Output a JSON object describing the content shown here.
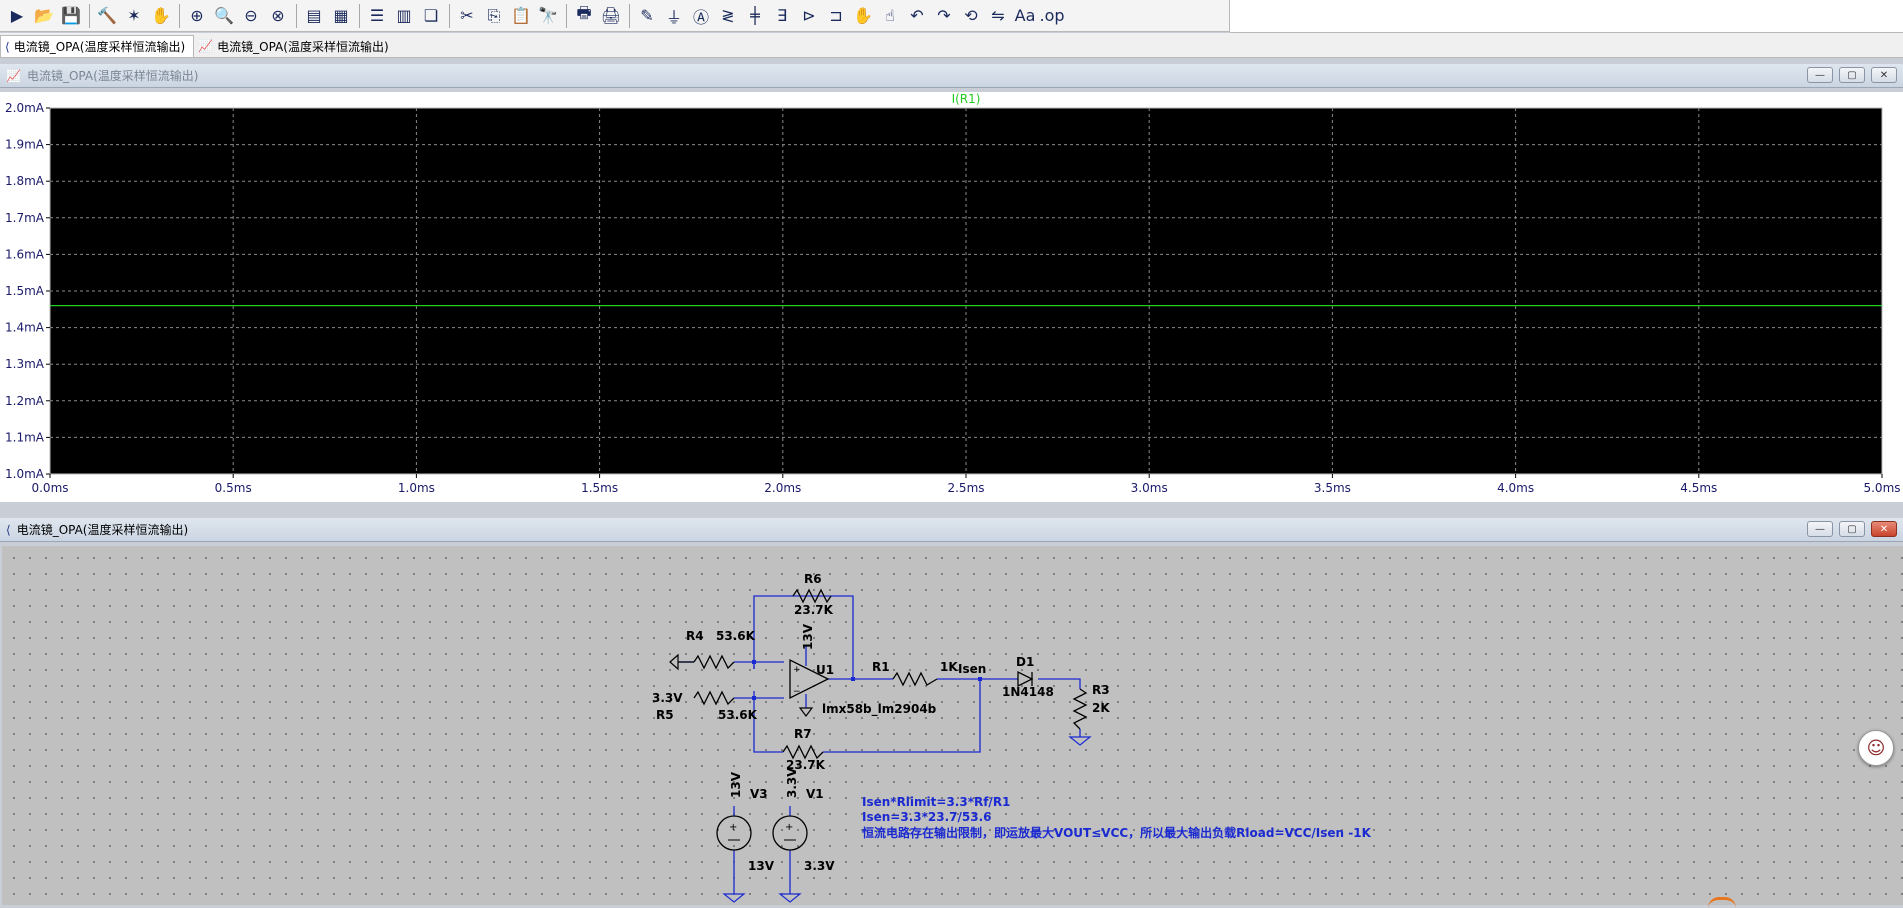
{
  "toolbar": {
    "icons": [
      {
        "name": "run-icon",
        "glyph": "▶"
      },
      {
        "name": "open-icon",
        "glyph": "📂"
      },
      {
        "name": "save-icon",
        "glyph": "💾"
      },
      {
        "sep": true
      },
      {
        "name": "control-panel-icon",
        "glyph": "🔨"
      },
      {
        "name": "halt-icon",
        "glyph": "✶"
      },
      {
        "name": "pan-hand-icon",
        "glyph": "✋"
      },
      {
        "sep": true
      },
      {
        "name": "zoom-in-icon",
        "glyph": "⊕"
      },
      {
        "name": "zoom-area-icon",
        "glyph": "🔍"
      },
      {
        "name": "zoom-out-icon",
        "glyph": "⊖"
      },
      {
        "name": "zoom-fit-icon",
        "glyph": "⊗"
      },
      {
        "sep": true
      },
      {
        "name": "autorange-icon",
        "glyph": "▤"
      },
      {
        "name": "grid-icon",
        "glyph": "▦"
      },
      {
        "sep": true
      },
      {
        "name": "tile-horizontal-icon",
        "glyph": "☰"
      },
      {
        "name": "tile-vertical-icon",
        "glyph": "▥"
      },
      {
        "name": "cascade-icon",
        "glyph": "❏"
      },
      {
        "sep": true
      },
      {
        "name": "cut-icon",
        "glyph": "✂"
      },
      {
        "name": "copy-icon",
        "glyph": "⎘"
      },
      {
        "name": "paste-icon",
        "glyph": "📋"
      },
      {
        "name": "find-icon",
        "glyph": "🔭"
      },
      {
        "sep": true
      },
      {
        "name": "print-icon",
        "glyph": "🖶"
      },
      {
        "name": "print-preview-icon",
        "glyph": "🖨"
      },
      {
        "sep": true
      },
      {
        "name": "draw-wire-icon",
        "glyph": "✎"
      },
      {
        "name": "ground-icon",
        "glyph": "⏚"
      },
      {
        "name": "label-net-icon",
        "glyph": "Ⓐ"
      },
      {
        "name": "resistor-icon",
        "glyph": "≷"
      },
      {
        "name": "capacitor-icon",
        "glyph": "╪"
      },
      {
        "name": "inductor-icon",
        "glyph": "∃"
      },
      {
        "name": "diode-icon",
        "glyph": "⊳"
      },
      {
        "name": "component-icon",
        "glyph": "⊐"
      },
      {
        "name": "move-icon",
        "glyph": "✋"
      },
      {
        "name": "drag-icon",
        "glyph": "☝"
      },
      {
        "name": "undo-icon",
        "glyph": "↶"
      },
      {
        "name": "redo-icon",
        "glyph": "↷"
      },
      {
        "name": "rotate-icon",
        "glyph": "⟲"
      },
      {
        "name": "mirror-icon",
        "glyph": "⇋"
      },
      {
        "name": "text-icon",
        "glyph": "Aa"
      },
      {
        "name": "spice-directive-icon",
        "glyph": ".op"
      }
    ]
  },
  "tabs": [
    {
      "label": "电流镜_OPA(温度采样恒流输出)",
      "icon": "schematic-icon",
      "active": true
    },
    {
      "label": "电流镜_OPA(温度采样恒流输出)",
      "icon": "waveform-icon",
      "active": false
    }
  ],
  "waveform_window": {
    "title": "电流镜_OPA(温度采样恒流输出)",
    "buttons": {
      "min": "—",
      "max": "▢",
      "close": "✕"
    }
  },
  "schematic_window": {
    "title": "电流镜_OPA(温度采样恒流输出)",
    "buttons": {
      "min": "—",
      "max": "▢",
      "close": "✕"
    }
  },
  "chart_data": {
    "type": "line",
    "title": "I(R1)",
    "xlabel": "",
    "ylabel": "",
    "xlim": [
      0.0,
      5.0
    ],
    "ylim": [
      1.0,
      2.0
    ],
    "grid": true,
    "background": "#000000",
    "grid_color": "#8a8a8a",
    "series": [
      {
        "name": "I(R1)",
        "color": "#22cc22",
        "x": [
          0.0,
          5.0
        ],
        "y": [
          1.46,
          1.46
        ]
      }
    ],
    "x_ticks": [
      {
        "v": 0.0,
        "label": "0.0ms"
      },
      {
        "v": 0.5,
        "label": "0.5ms"
      },
      {
        "v": 1.0,
        "label": "1.0ms"
      },
      {
        "v": 1.5,
        "label": "1.5ms"
      },
      {
        "v": 2.0,
        "label": "2.0ms"
      },
      {
        "v": 2.5,
        "label": "2.5ms"
      },
      {
        "v": 3.0,
        "label": "3.0ms"
      },
      {
        "v": 3.5,
        "label": "3.5ms"
      },
      {
        "v": 4.0,
        "label": "4.0ms"
      },
      {
        "v": 4.5,
        "label": "4.5ms"
      },
      {
        "v": 5.0,
        "label": "5.0ms"
      }
    ],
    "y_ticks": [
      {
        "v": 2.0,
        "label": "2.0mA"
      },
      {
        "v": 1.9,
        "label": "1.9mA"
      },
      {
        "v": 1.8,
        "label": "1.8mA"
      },
      {
        "v": 1.7,
        "label": "1.7mA"
      },
      {
        "v": 1.6,
        "label": "1.6mA"
      },
      {
        "v": 1.5,
        "label": "1.5mA"
      },
      {
        "v": 1.4,
        "label": "1.4mA"
      },
      {
        "v": 1.3,
        "label": "1.3mA"
      },
      {
        "v": 1.2,
        "label": "1.2mA"
      },
      {
        "v": 1.1,
        "label": "1.1mA"
      },
      {
        "v": 1.0,
        "label": "1.0mA"
      }
    ]
  },
  "schematic": {
    "wire_color": "#1a2ad0",
    "labels": {
      "r6_name": "R6",
      "r6_value": "23.7K",
      "r4_name": "R4",
      "r4_value": "53.6K",
      "r5_name": "R5",
      "r5_value": "53.6K",
      "r7_name": "R7",
      "r7_value": "23.7K",
      "r1_name": "R1",
      "r1_value": "1K",
      "r3_name": "R3",
      "r3_value": "2K",
      "d1_name": "D1",
      "d1_value": "1N4148",
      "u1_name": "U1",
      "u1_model": "lmx58b_lm2904b",
      "u1_supply": "13V",
      "input_voltage": "3.3V",
      "net_isen": "Isen",
      "v3_name": "V3",
      "v3_value": "13V",
      "v3_net": "13V",
      "v1_name": "V1",
      "v1_value": "3.3V",
      "v1_net": "3.3V"
    },
    "notes": [
      "Isen*Rlimit=3.3*Rf/R1",
      "Isen=3.3*23.7/53.6",
      "恒流电路存在输出限制，即运放最大VOUT≤VCC，所以最大输出负载Rload=VCC/Isen -1K"
    ]
  }
}
